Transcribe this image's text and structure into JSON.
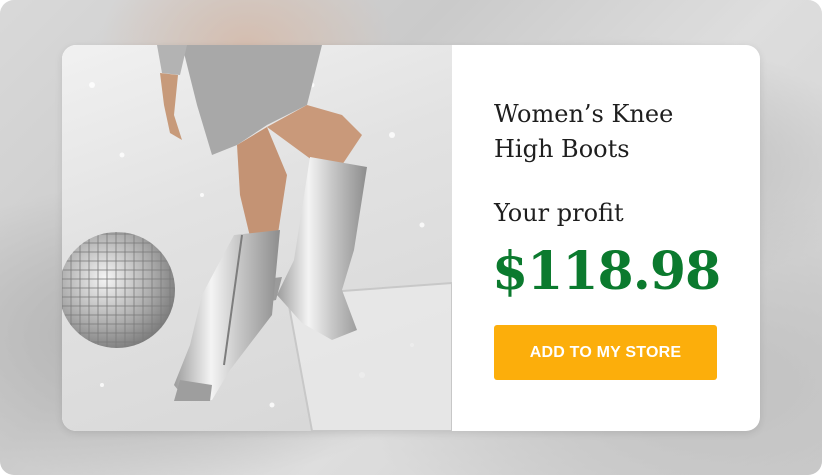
{
  "product": {
    "title_line1": "Women’s Knee",
    "title_line2": "High Boots",
    "profit_label": "Your profit",
    "price": "$118.98",
    "cta_label": "ADD TO MY STORE"
  },
  "colors": {
    "price": "#0b7a2e",
    "cta_background": "#fcae0b",
    "cta_text": "#ffffff"
  }
}
